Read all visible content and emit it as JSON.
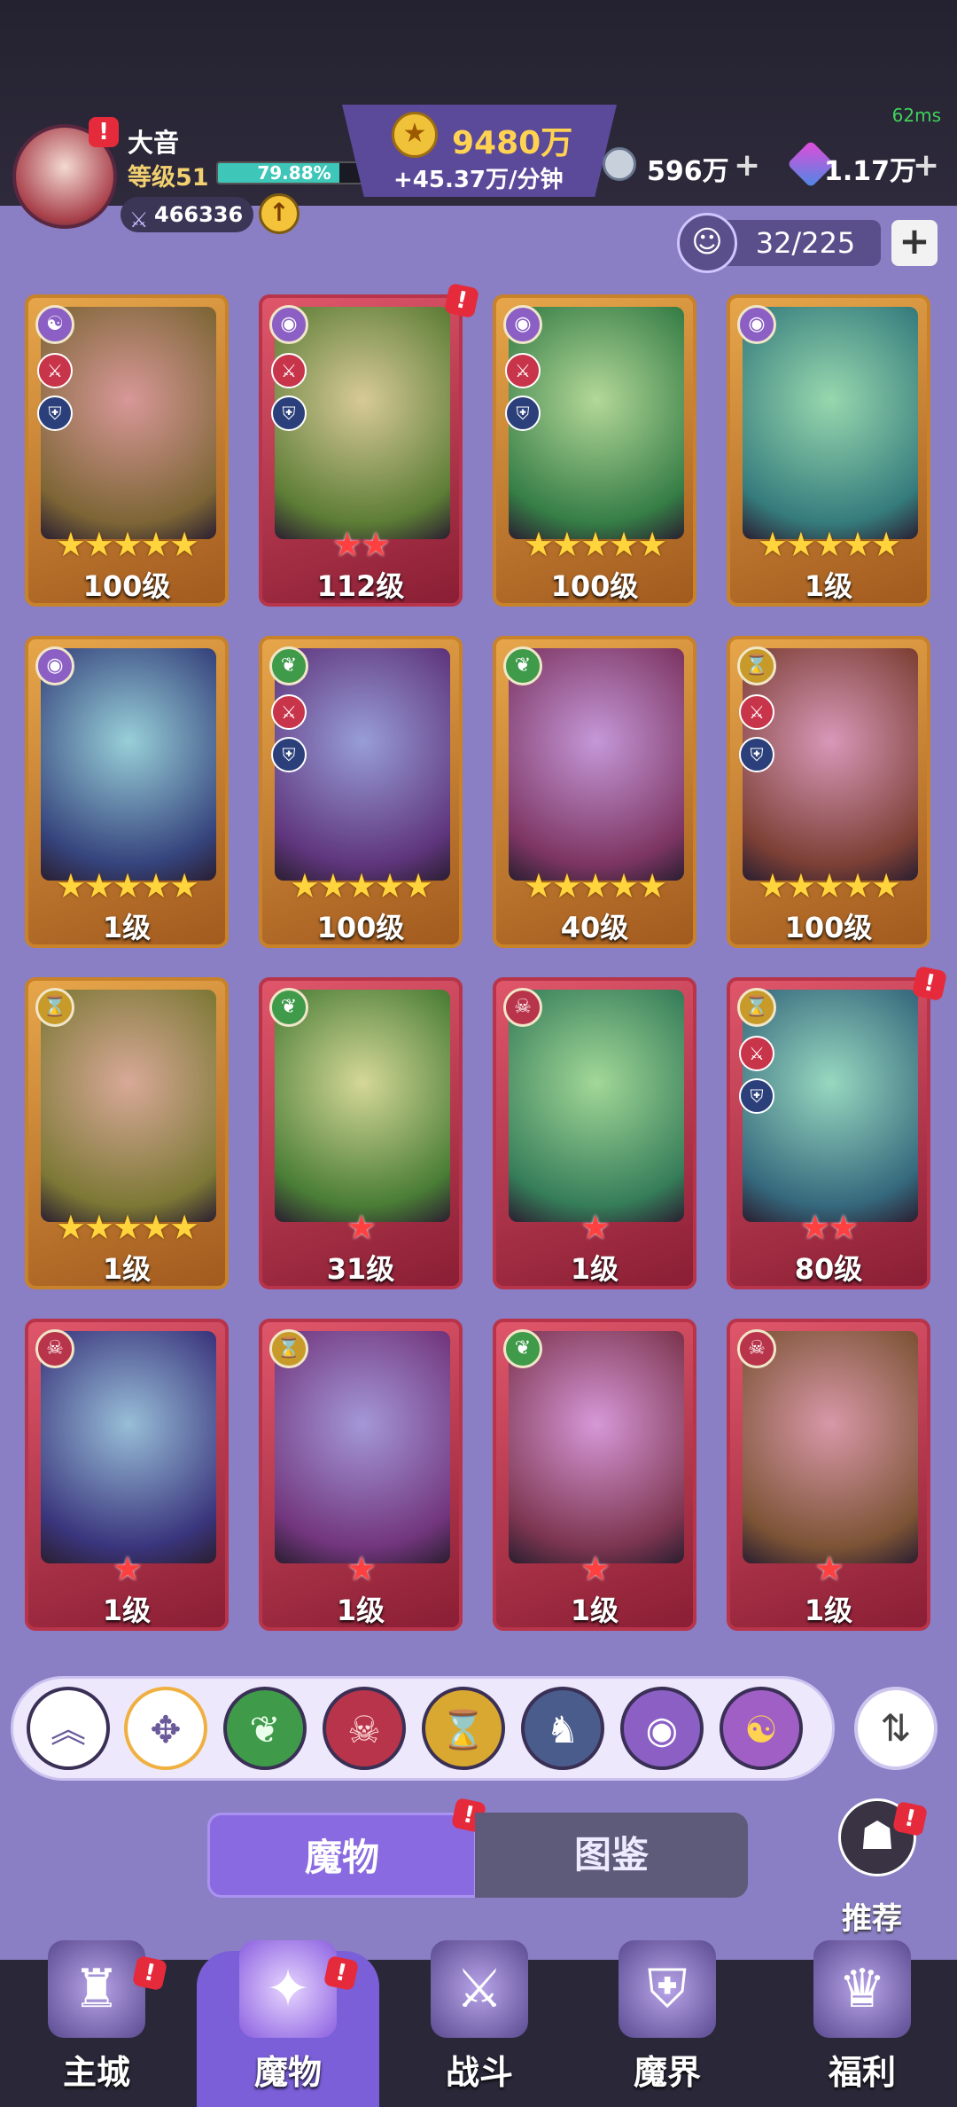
{
  "status": {
    "ping": "62ms"
  },
  "player": {
    "name": "大音",
    "level": "等级51",
    "exp_percent": "79.88%",
    "exp_fraction": 0.7988,
    "power": "466336"
  },
  "currency": {
    "gold": "9480万",
    "gold_rate": "+45.37万/分钟",
    "silver": "596万",
    "gem": "1.17万"
  },
  "collection": {
    "count": "32/225"
  },
  "monsters": [
    {
      "level": "100级",
      "stars": "★★★★★",
      "star_color": "gold",
      "frame": "gold",
      "element_icon": "☯",
      "element_color": "#8b5fc4",
      "has_role": true,
      "badge": false
    },
    {
      "level": "112级",
      "stars": "★★",
      "star_color": "red",
      "frame": "red",
      "element_icon": "◉",
      "element_color": "#8b5fc4",
      "has_role": true,
      "badge": true
    },
    {
      "level": "100级",
      "stars": "★★★★★",
      "star_color": "gold",
      "frame": "gold",
      "element_icon": "◉",
      "element_color": "#8b5fc4",
      "has_role": true,
      "badge": false
    },
    {
      "level": "1级",
      "stars": "★★★★★",
      "star_color": "gold",
      "frame": "gold",
      "element_icon": "◉",
      "element_color": "#8b5fc4",
      "has_role": false,
      "badge": false
    },
    {
      "level": "1级",
      "stars": "★★★★★",
      "star_color": "gold",
      "frame": "gold",
      "element_icon": "◉",
      "element_color": "#8b5fc4",
      "has_role": false,
      "badge": false
    },
    {
      "level": "100级",
      "stars": "★★★★★",
      "star_color": "gold",
      "frame": "gold",
      "element_icon": "❦",
      "element_color": "#3f9a4a",
      "has_role": true,
      "badge": false
    },
    {
      "level": "40级",
      "stars": "★★★★★",
      "star_color": "gold",
      "frame": "gold",
      "element_icon": "❦",
      "element_color": "#3f9a4a",
      "has_role": false,
      "badge": false
    },
    {
      "level": "100级",
      "stars": "★★★★★",
      "star_color": "gold",
      "frame": "gold",
      "element_icon": "⌛",
      "element_color": "#c89a2a",
      "has_role": true,
      "badge": false
    },
    {
      "level": "1级",
      "stars": "★★★★★",
      "star_color": "gold",
      "frame": "gold",
      "element_icon": "⌛",
      "element_color": "#c89a2a",
      "has_role": false,
      "badge": false
    },
    {
      "level": "31级",
      "stars": "★",
      "star_color": "red",
      "frame": "red",
      "element_icon": "❦",
      "element_color": "#3f9a4a",
      "has_role": false,
      "badge": false
    },
    {
      "level": "1级",
      "stars": "★",
      "star_color": "red",
      "frame": "red",
      "element_icon": "☠",
      "element_color": "#b8344a",
      "has_role": false,
      "badge": false
    },
    {
      "level": "80级",
      "stars": "★★",
      "star_color": "red",
      "frame": "red",
      "element_icon": "⌛",
      "element_color": "#c89a2a",
      "has_role": true,
      "badge": true
    },
    {
      "level": "1级",
      "stars": "★",
      "star_color": "red",
      "frame": "red",
      "element_icon": "☠",
      "element_color": "#b8344a",
      "has_role": false,
      "badge": false
    },
    {
      "level": "1级",
      "stars": "★",
      "star_color": "red",
      "frame": "red",
      "element_icon": "⌛",
      "element_color": "#c89a2a",
      "has_role": false,
      "badge": false
    },
    {
      "level": "1级",
      "stars": "★",
      "star_color": "red",
      "frame": "red",
      "element_icon": "❦",
      "element_color": "#3f9a4a",
      "has_role": false,
      "badge": false
    },
    {
      "level": "1级",
      "stars": "★",
      "star_color": "red",
      "frame": "red",
      "element_icon": "☠",
      "element_color": "#b8344a",
      "has_role": false,
      "badge": false
    }
  ],
  "filters": [
    {
      "name": "all",
      "icon": "✥",
      "bg": "#ffffff",
      "fg": "#6a5a9a"
    },
    {
      "name": "nature",
      "icon": "❦",
      "bg": "#3f9a4a",
      "fg": "#eaffea"
    },
    {
      "name": "demon",
      "icon": "☠",
      "bg": "#b8344a",
      "fg": "#ffe0e0"
    },
    {
      "name": "time",
      "icon": "⌛",
      "bg": "#d8a830",
      "fg": "#5a3a00"
    },
    {
      "name": "dragon",
      "icon": "♞",
      "bg": "#4a5c8c",
      "fg": "#ffffff"
    },
    {
      "name": "eye",
      "icon": "◉",
      "bg": "#8b5fc4",
      "fg": "#ffffff"
    },
    {
      "name": "arcane",
      "icon": "☯",
      "bg": "#a05fc4",
      "fg": "#ffd351"
    }
  ],
  "tabs": {
    "monster": "魔物",
    "codex": "图鉴"
  },
  "recommend": {
    "label": "推荐"
  },
  "nav": [
    {
      "label": "主城",
      "icon": "♜",
      "badge": true
    },
    {
      "label": "魔物",
      "icon": "✦",
      "badge": true
    },
    {
      "label": "战斗",
      "icon": "⚔",
      "badge": false
    },
    {
      "label": "魔界",
      "icon": "⛨",
      "badge": false
    },
    {
      "label": "福利",
      "icon": "♛",
      "badge": false
    }
  ]
}
